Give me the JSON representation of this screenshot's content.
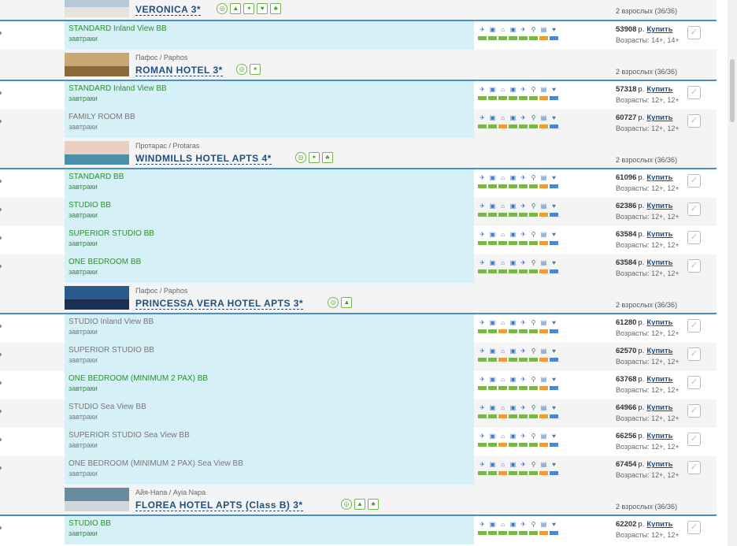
{
  "colors": {
    "green": "#7ab648",
    "orange": "#f39a33",
    "blue": "#4c87c7",
    "accent": "#4a8fc4",
    "highlight": "#d6f0f8"
  },
  "service_icons": [
    "plane-icon",
    "bus-icon",
    "home-icon",
    "bus-icon",
    "plane-icon",
    "pin-icon",
    "luggage-icon",
    "shield-icon"
  ],
  "buy_label": "Купить",
  "hotels": [
    {
      "location": "",
      "name": "VERONICA 3*",
      "guests": "2 взрослых (36/36)",
      "amenities": [
        "wifi",
        "like",
        "fitness",
        "heart",
        "kids"
      ],
      "thumb": [
        "#b8c8d8",
        "#e8e4dc"
      ],
      "rooms": [
        {
          "name": "STANDARD Inland View BB",
          "meal": "завтраки",
          "price": "53908",
          "currency": "р.",
          "ages": "Возрасты: 14+, 14+",
          "grey": false,
          "bar": [
            "green",
            "green",
            "green",
            "green",
            "green",
            "green",
            "orange",
            "blue"
          ]
        }
      ]
    },
    {
      "location": "Пафос / Paphos",
      "name": "ROMAN HOTEL 3*",
      "guests": "2 взрослых (36/36)",
      "amenities": [
        "wifi",
        "fitness"
      ],
      "thumb": [
        "#c8a870",
        "#8a6a3a"
      ],
      "rooms": [
        {
          "name": "STANDARD Inland View BB",
          "meal": "завтраки",
          "price": "57318",
          "currency": "р.",
          "ages": "Возрасты: 12+, 12+",
          "grey": false,
          "bar": [
            "green",
            "green",
            "green",
            "green",
            "green",
            "green",
            "orange",
            "blue"
          ]
        },
        {
          "name": "FAMILY ROOM BB",
          "meal": "завтраки",
          "price": "60727",
          "currency": "р.",
          "ages": "Возрасты: 12+, 12+",
          "grey": true,
          "bar": [
            "green",
            "green",
            "orange",
            "green",
            "green",
            "green",
            "orange",
            "blue"
          ]
        }
      ]
    },
    {
      "location": "Протарас / Protaras",
      "name": "WINDMILLS HOTEL APTS 4*",
      "guests": "2 взрослых (36/36)",
      "amenities": [
        "wifi",
        "fitness",
        "kids"
      ],
      "thumb": [
        "#e8cfc0",
        "#4a90a8"
      ],
      "rooms": [
        {
          "name": "STANDARD BB",
          "meal": "завтраки",
          "price": "61096",
          "currency": "р.",
          "ages": "Возрасты: 12+, 12+",
          "grey": false,
          "bar": [
            "green",
            "green",
            "green",
            "green",
            "green",
            "green",
            "orange",
            "blue"
          ]
        },
        {
          "name": "STUDIO BB",
          "meal": "завтраки",
          "price": "62386",
          "currency": "р.",
          "ages": "Возрасты: 12+, 12+",
          "grey": false,
          "bar": [
            "green",
            "green",
            "green",
            "green",
            "green",
            "green",
            "orange",
            "blue"
          ]
        },
        {
          "name": "SUPERIOR STUDIO BB",
          "meal": "завтраки",
          "price": "63584",
          "currency": "р.",
          "ages": "Возрасты: 12+, 12+",
          "grey": false,
          "bar": [
            "green",
            "green",
            "green",
            "green",
            "green",
            "green",
            "orange",
            "blue"
          ]
        },
        {
          "name": "ONE BEDROOM BB",
          "meal": "завтраки",
          "price": "63584",
          "currency": "р.",
          "ages": "Возрасты: 12+, 12+",
          "grey": false,
          "bar": [
            "green",
            "green",
            "green",
            "green",
            "green",
            "green",
            "orange",
            "blue"
          ]
        }
      ]
    },
    {
      "location": "Пафос / Paphos",
      "name": "PRINCESSA VERA HOTEL APTS 3*",
      "guests": "2 взрослых (36/36)",
      "amenities": [
        "wifi",
        "like"
      ],
      "thumb": [
        "#2a5a8a",
        "#1a3050"
      ],
      "rooms": [
        {
          "name": "STUDIO Inland View BB",
          "meal": "завтраки",
          "price": "61280",
          "currency": "р.",
          "ages": "Возрасты: 12+, 12+",
          "grey": true,
          "bar": [
            "green",
            "green",
            "orange",
            "green",
            "green",
            "green",
            "orange",
            "blue"
          ]
        },
        {
          "name": "SUPERIOR STUDIO BB",
          "meal": "завтраки",
          "price": "62570",
          "currency": "р.",
          "ages": "Возрасты: 12+, 12+",
          "grey": true,
          "bar": [
            "green",
            "green",
            "orange",
            "green",
            "green",
            "green",
            "orange",
            "blue"
          ]
        },
        {
          "name": "ONE BEDROOM (MINIMUM 2 PAX) BB",
          "meal": "завтраки",
          "price": "63768",
          "currency": "р.",
          "ages": "Возрасты: 12+, 12+",
          "grey": false,
          "bar": [
            "green",
            "green",
            "green",
            "green",
            "green",
            "green",
            "orange",
            "blue"
          ]
        },
        {
          "name": "STUDIO Sea View BB",
          "meal": "завтраки",
          "price": "64966",
          "currency": "р.",
          "ages": "Возрасты: 12+, 12+",
          "grey": true,
          "bar": [
            "green",
            "green",
            "orange",
            "green",
            "green",
            "green",
            "orange",
            "blue"
          ]
        },
        {
          "name": "SUPERIOR STUDIO Sea View BB",
          "meal": "завтраки",
          "price": "66256",
          "currency": "р.",
          "ages": "Возрасты: 12+, 12+",
          "grey": true,
          "bar": [
            "green",
            "green",
            "orange",
            "green",
            "green",
            "green",
            "orange",
            "blue"
          ]
        },
        {
          "name": "ONE BEDROOM (MINIMUM 2 PAX) Sea View BB",
          "meal": "завтраки",
          "price": "67454",
          "currency": "р.",
          "ages": "Возрасты: 12+, 12+",
          "grey": true,
          "bar": [
            "green",
            "green",
            "orange",
            "green",
            "green",
            "green",
            "orange",
            "blue"
          ]
        }
      ]
    },
    {
      "location": "Айя-Напа / Ayia Napa",
      "name": "FLOREA HOTEL APTS (Class B) 3*",
      "guests": "2 взрослых (36/36)",
      "amenities": [
        "wifi",
        "like",
        "kids"
      ],
      "thumb": [
        "#6a8aa0",
        "#d0d8dc"
      ],
      "rooms": [
        {
          "name": "STUDIO BB",
          "meal": "завтраки",
          "price": "62202",
          "currency": "р.",
          "ages": "Возрасты: 12+, 12+",
          "grey": false,
          "bar": [
            "green",
            "green",
            "green",
            "green",
            "green",
            "green",
            "orange",
            "blue"
          ]
        }
      ]
    }
  ]
}
